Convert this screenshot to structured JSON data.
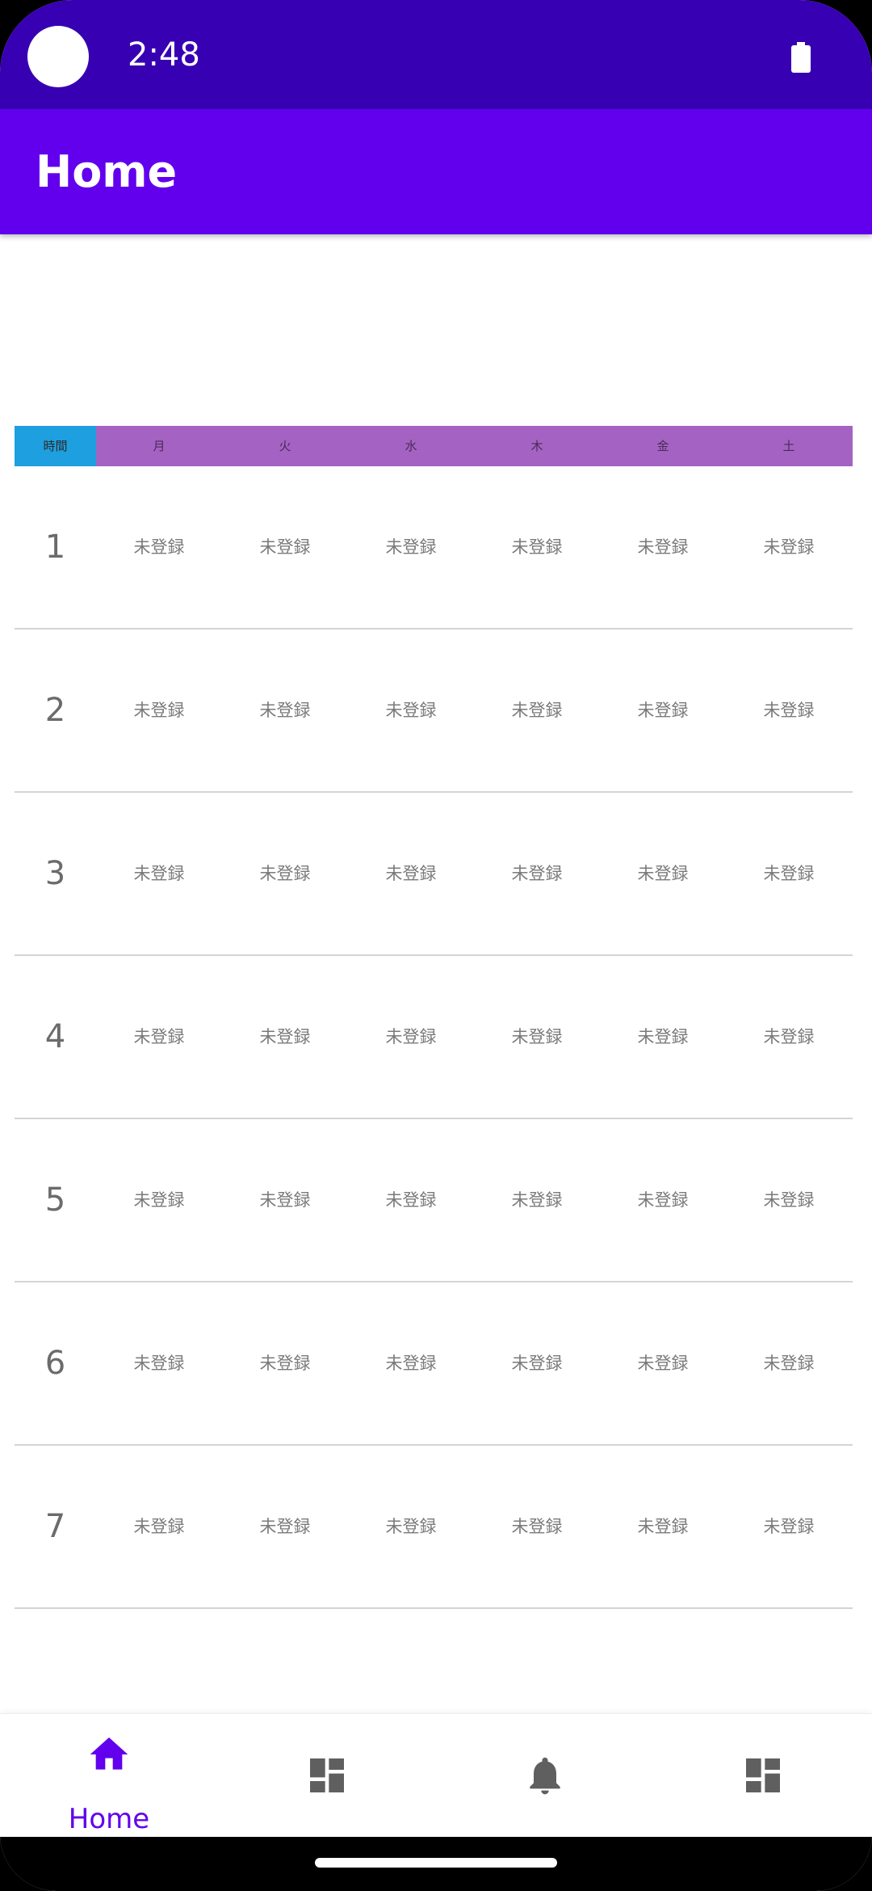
{
  "status_bar": {
    "time": "2:48",
    "icons": [
      "battery-icon"
    ],
    "background": "#3700b3"
  },
  "app_bar": {
    "title": "Home",
    "background": "#6200ee"
  },
  "timetable": {
    "header": {
      "time_label": "時間",
      "days": [
        "月",
        "火",
        "水",
        "木",
        "金",
        "土"
      ]
    },
    "rows": [
      {
        "period": "1",
        "cells": [
          "未登録",
          "未登録",
          "未登録",
          "未登録",
          "未登録",
          "未登録"
        ]
      },
      {
        "period": "2",
        "cells": [
          "未登録",
          "未登録",
          "未登録",
          "未登録",
          "未登録",
          "未登録"
        ]
      },
      {
        "period": "3",
        "cells": [
          "未登録",
          "未登録",
          "未登録",
          "未登録",
          "未登録",
          "未登録"
        ]
      },
      {
        "period": "4",
        "cells": [
          "未登録",
          "未登録",
          "未登録",
          "未登録",
          "未登録",
          "未登録"
        ]
      },
      {
        "period": "5",
        "cells": [
          "未登録",
          "未登録",
          "未登録",
          "未登録",
          "未登録",
          "未登録"
        ]
      },
      {
        "period": "6",
        "cells": [
          "未登録",
          "未登録",
          "未登録",
          "未登録",
          "未登録",
          "未登録"
        ]
      },
      {
        "period": "7",
        "cells": [
          "未登録",
          "未登録",
          "未登録",
          "未登録",
          "未登録",
          "未登録"
        ]
      }
    ],
    "colors": {
      "time_header": "#1e9fdf",
      "day_header": "#a463c2"
    }
  },
  "bottom_nav": {
    "items": [
      {
        "label": "Home",
        "icon": "home-icon",
        "selected": true
      },
      {
        "label": "",
        "icon": "dashboard-icon",
        "selected": false
      },
      {
        "label": "",
        "icon": "bell-icon",
        "selected": false
      },
      {
        "label": "",
        "icon": "dashboard-icon",
        "selected": false
      }
    ],
    "selected_color": "#6200ee",
    "unselected_color": "#5f5f5f"
  }
}
